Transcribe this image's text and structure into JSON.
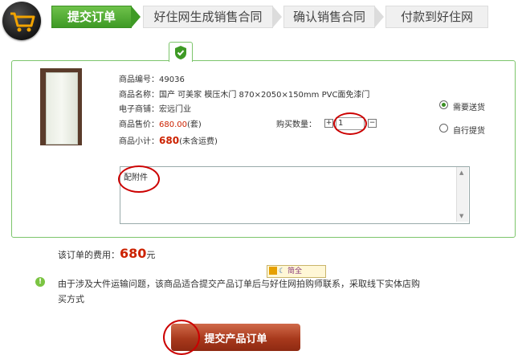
{
  "steps": [
    "提交订单",
    "好住网生成销售合同",
    "确认销售合同",
    "付款到好住网"
  ],
  "product": {
    "code_label": "商品编号：",
    "code": "49036",
    "name_label": "商品名称：",
    "name": "国产 可美家 模压木门 870×2050×150mm PVC面免漆门",
    "store_label": "电子商铺：",
    "store": "宏远门业",
    "price_label": "商品售价：",
    "price": "680.00",
    "price_unit": "(套)",
    "subtotal_label": "商品小计：",
    "subtotal": "680",
    "subtotal_note": "(未含运费)"
  },
  "quantity": {
    "label": "购买数量：",
    "value": "1",
    "plus": "+",
    "minus": "−"
  },
  "delivery": {
    "option1": "需要送货",
    "option2": "自行提货",
    "selected": "需要送货"
  },
  "notes": {
    "value": "配附件"
  },
  "fee": {
    "label": "该订单的费用：",
    "amount": "680",
    "unit": "元"
  },
  "notice": {
    "line1": "由于涉及大件运输问题，该商品适合提交产品订单后与好住网拍购师联系，采取线下实体店购",
    "line2": "买方式"
  },
  "logo_text": "简全",
  "submit_label": "提交产品订单",
  "colors": {
    "green": "#3e9a25",
    "red": "#cc2200"
  }
}
